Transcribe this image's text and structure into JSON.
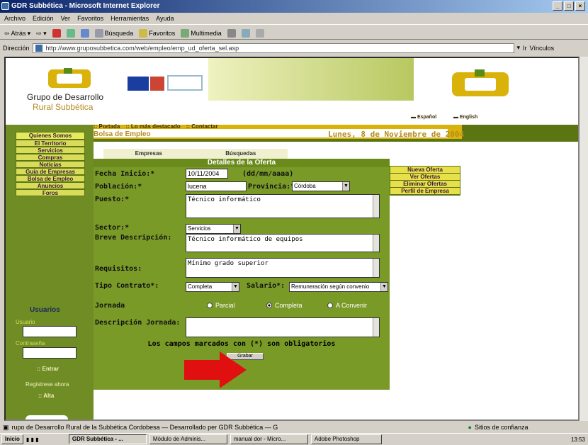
{
  "window": {
    "title": "GDR Subbética - Microsoft Internet Explorer"
  },
  "menu": [
    "Archivo",
    "Edición",
    "Ver",
    "Favoritos",
    "Herramientas",
    "Ayuda"
  ],
  "toolbar": {
    "back": "Atrás",
    "search": "Búsqueda",
    "favorites": "Favoritos",
    "multimedia": "Multimedia"
  },
  "address": {
    "label": "Dirección",
    "url": "http://www.gruposubbetica.com/web/empleo/emp_ud_oferta_sel.asp",
    "go": "Ir",
    "links": "Vínculos"
  },
  "logo": {
    "line1": "Grupo de Desarrollo",
    "line2": "Rural Subbética"
  },
  "lang": {
    "es": "Español",
    "en": "English"
  },
  "toplinks": [
    ":: Portada",
    ":: Lo más destacado",
    ":: Contactar"
  ],
  "section": "Bolsa de Empleo",
  "date": "Lunes, 8 de Noviembre de 2004",
  "nav": [
    "Quienes Somos",
    "El Territorio",
    "Servicios",
    "Compras",
    "Noticias",
    "Guía de Empresas",
    "Bolsa de Empleo",
    "Anuncios",
    "Foros"
  ],
  "tabs": [
    "Empresas",
    "Búsquedas"
  ],
  "form": {
    "title": "Detalles de la Oferta",
    "fecha_label": "Fecha Inicio:*",
    "fecha_value": "10/11/2004",
    "fecha_hint": "(dd/mm/aaaa)",
    "poblacion_label": "Población:*",
    "poblacion_value": "lucena",
    "provincia_label": "Provincia:*",
    "provincia_value": "Córdoba",
    "puesto_label": "Puesto:*",
    "puesto_value": "Técnico informático",
    "sector_label": "Sector:*",
    "sector_value": "Servicios",
    "breve_label": "Breve Descripción:",
    "breve_value": "Técnico informático de equipos",
    "requisitos_label": "Requisitos:",
    "requisitos_value": "Mínimo grado superior",
    "contrato_label": "Tipo Contrato*:",
    "contrato_value": "Completa",
    "salario_label": "Salario*:",
    "salario_value": "Remuneración según convenio",
    "jornada_label": "Jornada",
    "jornada_opts": [
      "Parcial",
      "Completa",
      "A Convenir"
    ],
    "descjornada_label": "Descripción Jornada:",
    "required_note": "Los campos marcados con (*) son obligatorios",
    "save": "Grabar"
  },
  "sidemenu": [
    "Nueva Oferta",
    "Ver Ofertas",
    "Eliminar Ofertas",
    "Perfil de Empresa"
  ],
  "users": {
    "title": "Usuarios",
    "user_label": "Usuario",
    "pass_label": "Contraseña",
    "enter": ":: Entrar",
    "register": "Regístrese ahora",
    "alta": ":: Alta"
  },
  "status": {
    "text": "rupo de Desarrollo Rural de la Subbética Cordobesa  —  Desarrollado per GDR Subbética  —  G",
    "zone": "Sitios de confianza"
  },
  "taskbar": {
    "start": "Inicio",
    "items": [
      "GDR Subbética - ...",
      "Módulo de Adminis...",
      "manual dor - Micro...",
      "Adobe Photoshop"
    ],
    "clock": "13:53"
  }
}
